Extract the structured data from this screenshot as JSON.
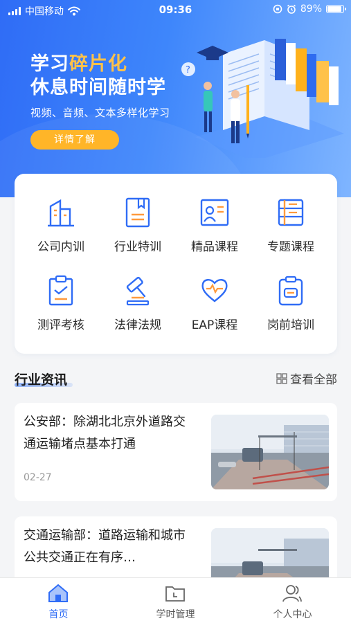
{
  "status_bar": {
    "carrier": "中国移动",
    "time": "09:36",
    "battery_percent": "89%",
    "battery_level": 0.89,
    "icons": [
      "signal-icon",
      "wifi-icon",
      "rotation-lock-icon",
      "alarm-icon",
      "battery-icon"
    ]
  },
  "banner": {
    "title_prefix": "学习",
    "title_highlight": "碎片化",
    "title_line2": "休息时间随时学",
    "subtitle": "视频、音频、文本多样化学习",
    "button_label": "详情了解",
    "colors": {
      "gradient_start": "#2f6cf6",
      "gradient_end": "#7fb5ff",
      "highlight": "#ffc24a",
      "button": "#ffb11b"
    }
  },
  "categories": [
    {
      "label": "公司内训",
      "icon": "company-building-icon"
    },
    {
      "label": "行业特训",
      "icon": "industry-book-icon"
    },
    {
      "label": "精品课程",
      "icon": "premium-course-icon"
    },
    {
      "label": "专题课程",
      "icon": "topic-course-icon"
    },
    {
      "label": "测评考核",
      "icon": "assessment-clipboard-icon"
    },
    {
      "label": "法律法规",
      "icon": "law-gavel-icon"
    },
    {
      "label": "EAP课程",
      "icon": "eap-heart-stethoscope-icon"
    },
    {
      "label": "岗前培训",
      "icon": "pre-job-training-icon"
    }
  ],
  "news_section": {
    "title": "行业资讯",
    "view_all_label": "查看全部",
    "items": [
      {
        "title": "公安部：除湖北北京外道路交通运输堵点基本打通",
        "date": "02-27"
      },
      {
        "title": "交通运输部：道路运输和城市公共交通正在有序…",
        "date": ""
      }
    ]
  },
  "tab_bar": {
    "items": [
      {
        "label": "首页",
        "icon": "home-icon",
        "active": true
      },
      {
        "label": "学时管理",
        "icon": "folder-clock-icon",
        "active": false
      },
      {
        "label": "个人中心",
        "icon": "user-group-icon",
        "active": false
      }
    ],
    "active_color": "#2f6cf6"
  }
}
